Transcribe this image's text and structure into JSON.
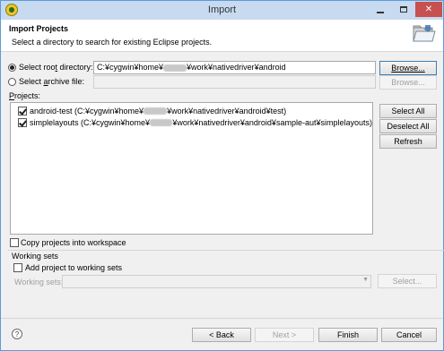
{
  "window": {
    "title": "Import"
  },
  "banner": {
    "title": "Import Projects",
    "description": "Select a directory to search for existing Eclipse projects."
  },
  "source": {
    "root_label": "Select roo",
    "root_label_ul": "t",
    "root_label_rest": " directory:",
    "root_value": "C:¥cygwin¥home¥",
    "root_value_rest": "¥work¥nativedriver¥android",
    "browse1": "Browse...",
    "archive_label_pre": "Select ",
    "archive_label_ul": "a",
    "archive_label_rest": "rchive file:",
    "browse2": "Browse..."
  },
  "projects": {
    "label_ul": "P",
    "label_rest": "rojects:",
    "items": [
      {
        "name": "android-test (C:¥cygwin¥home¥",
        "rest": "¥work¥nativedriver¥android¥test)"
      },
      {
        "name": "simplelayouts (C:¥cygwin¥home¥",
        "rest": "¥work¥nativedriver¥android¥sample-aut¥simplelayouts)"
      }
    ],
    "select_all": "Select All",
    "deselect_all": "Deselect All",
    "refresh": "Refresh"
  },
  "copy_label": "Copy projects into workspace",
  "working_sets": {
    "group_label": "Working sets",
    "add_label": "Add project to working sets",
    "sets_label": "Working sets:",
    "select_btn": "Select..."
  },
  "footer": {
    "help": "?",
    "back": "< Back",
    "next": "Next >",
    "finish": "Finish",
    "cancel": "Cancel"
  },
  "colors": {
    "title_bar": "#c7daf0",
    "close_button": "#c75050",
    "dialog_bg": "#f0f0f0"
  }
}
